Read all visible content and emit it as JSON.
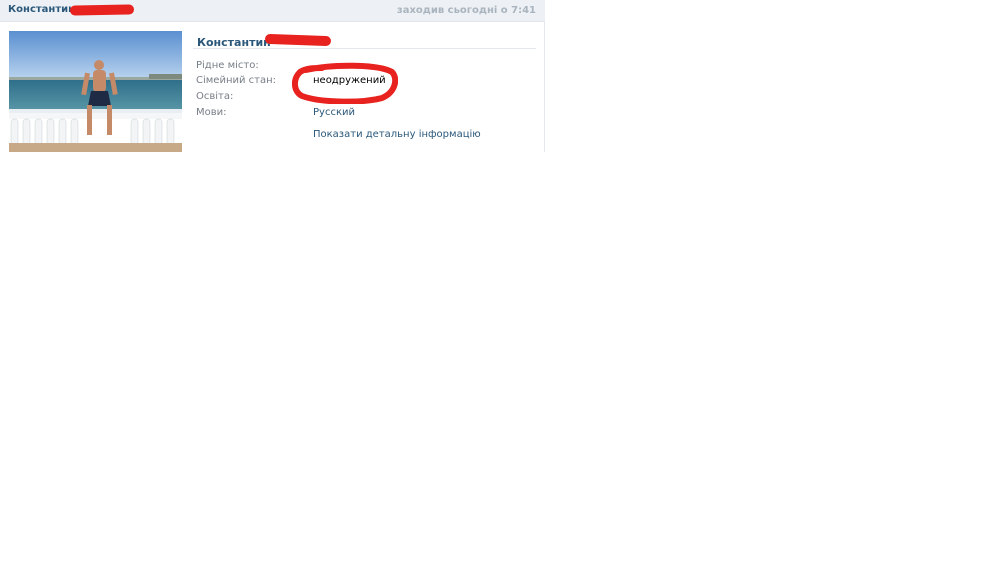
{
  "header": {
    "name": "Константин",
    "status": "заходив сьогодні о 7:41"
  },
  "profile": {
    "name": "Константин",
    "fields": [
      {
        "label": "Рідне місто:",
        "value": ""
      },
      {
        "label": "Сімейний стан:",
        "value": "неодружений"
      },
      {
        "label": "Освіта:",
        "value": ""
      },
      {
        "label": "Мови:",
        "value": "Русский"
      }
    ],
    "details_link": "Показати детальну інформацію"
  },
  "colors": {
    "header_bg": "#edf1f5",
    "link": "#2b587a",
    "label": "#777e87",
    "redaction": "#e8221e"
  }
}
